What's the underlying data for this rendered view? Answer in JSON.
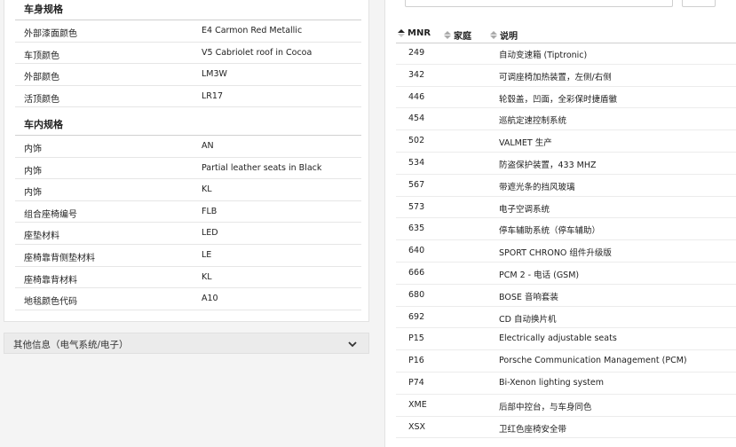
{
  "body_specs": {
    "title": "车身规格",
    "rows": [
      {
        "key": "外部漆面颜色",
        "value": "E4 Carmon Red Metallic"
      },
      {
        "key": "车顶颜色",
        "value": "V5 Cabriolet roof in Cocoa"
      },
      {
        "key": "外部颜色",
        "value": "LM3W"
      },
      {
        "key": "活顶颜色",
        "value": "LR17"
      }
    ]
  },
  "interior_specs": {
    "title": "车内规格",
    "rows": [
      {
        "key": "内饰",
        "value": "AN"
      },
      {
        "key": "内饰",
        "value": "Partial leather seats in Black"
      },
      {
        "key": "内饰",
        "value": "KL"
      },
      {
        "key": "组合座椅编号",
        "value": "FLB"
      },
      {
        "key": "座垫材料",
        "value": "LED"
      },
      {
        "key": "座椅靠背侧垫材料",
        "value": "LE"
      },
      {
        "key": "座椅靠背材料",
        "value": "KL"
      },
      {
        "key": "地毯颜色代码",
        "value": "A10"
      }
    ]
  },
  "accordion": {
    "label": "其他信息（电气系统/电子）",
    "icon": "chevron-down-icon"
  },
  "options_table": {
    "columns": {
      "mnr": "MNR",
      "family": "家庭",
      "description": "说明"
    },
    "rows": [
      {
        "mnr": "249",
        "desc": "自动变速箱 (Tiptronic)"
      },
      {
        "mnr": "342",
        "desc": "可调座椅加热装置，左侧/右侧"
      },
      {
        "mnr": "446",
        "desc": "轮毂盖，凹面，全彩保时捷盾徽"
      },
      {
        "mnr": "454",
        "desc": "巡航定速控制系统"
      },
      {
        "mnr": "502",
        "desc": "VALMET 生产"
      },
      {
        "mnr": "534",
        "desc": "防盗保护装置，433 MHZ"
      },
      {
        "mnr": "567",
        "desc": "带遮光条的挡风玻璃"
      },
      {
        "mnr": "573",
        "desc": "电子空调系统"
      },
      {
        "mnr": "635",
        "desc": "停车辅助系统（停车辅助）"
      },
      {
        "mnr": "640",
        "desc": "SPORT CHRONO 组件升级版"
      },
      {
        "mnr": "666",
        "desc": "PCM 2 - 电话 (GSM)"
      },
      {
        "mnr": "680",
        "desc": "BOSE 音响套装"
      },
      {
        "mnr": "692",
        "desc": "CD 自动换片机"
      },
      {
        "mnr": "P15",
        "desc": "Electrically adjustable seats"
      },
      {
        "mnr": "P16",
        "desc": "Porsche Communication Management (PCM)"
      },
      {
        "mnr": "P74",
        "desc": "Bi-Xenon lighting system"
      },
      {
        "mnr": "XME",
        "desc": "后部中控台，与车身同色"
      },
      {
        "mnr": "XSX",
        "desc": "卫红色座椅安全带"
      }
    ]
  },
  "colors": {
    "accent_text": "#222222",
    "panel_bg": "#ffffff",
    "page_bg": "#f4f4f4",
    "accordion_bg": "#ebebeb"
  }
}
